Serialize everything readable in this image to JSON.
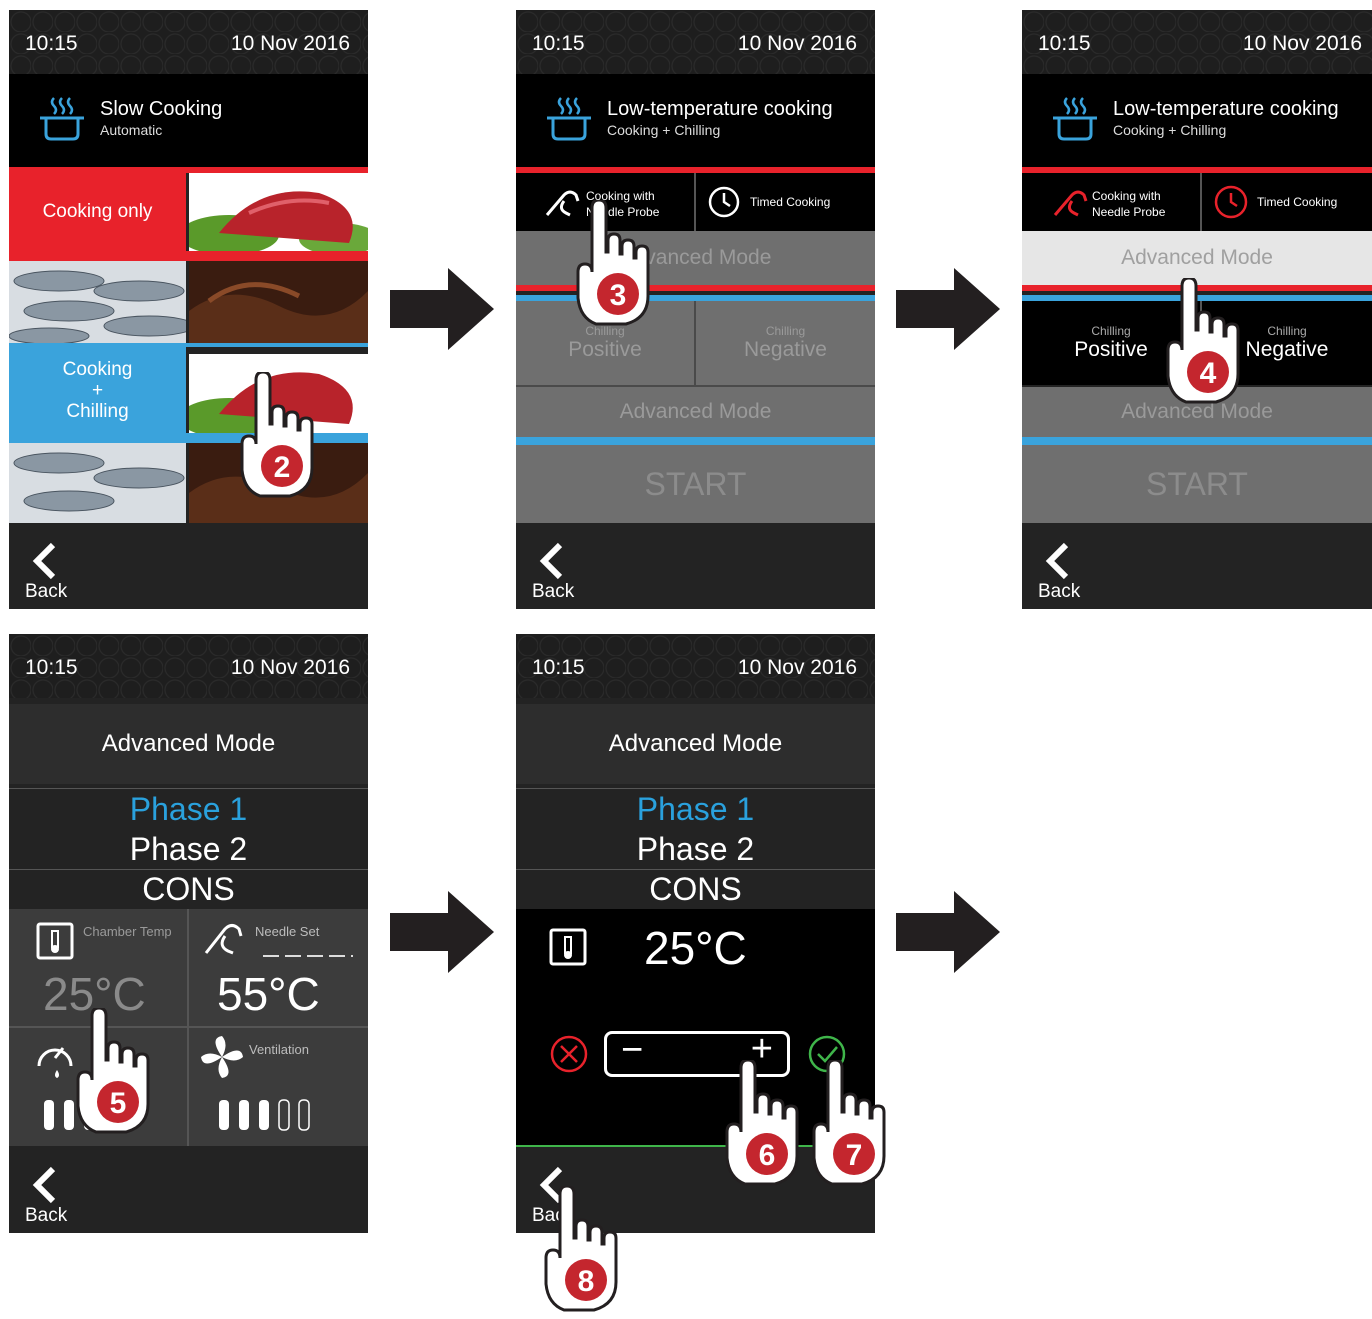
{
  "status": {
    "time": "10:15",
    "date": "10  Nov  2016"
  },
  "footer": {
    "back_label": "Back"
  },
  "screen1": {
    "title": "Slow Cooking",
    "subtitle": "Automatic",
    "cooking_only": "Cooking only",
    "cooking_chilling": [
      "Cooking",
      "+",
      "Chilling"
    ]
  },
  "screen2": {
    "title": "Low-temperature cooking",
    "subtitle": "Cooking + Chilling",
    "probe_label": [
      "Cooking with",
      "Needle Probe"
    ],
    "timed_label": "Timed Cooking",
    "advanced_top": "Advanced Mode",
    "chilling_small": "Chilling",
    "positive": "Positive",
    "negative": "Negative",
    "advanced_bottom": "Advanced Mode",
    "start": "START"
  },
  "screen4": {
    "title": "Advanced Mode",
    "phase1": "Phase 1",
    "phase2": "Phase 2",
    "cons": "CONS",
    "chamber_label": "Chamber Temp",
    "chamber_value": "25°C",
    "needle_label": "Needle Set",
    "needle_value": "55°C",
    "ventilation_label": "Ventilation",
    "speed_level": 3,
    "speed_total": 5,
    "vent_level": 3,
    "vent_total": 5
  },
  "screen5": {
    "title": "Advanced Mode",
    "phase1": "Phase 1",
    "phase2": "Phase 2",
    "cons": "CONS",
    "temp_value": "25°C",
    "minus": "−",
    "plus": "+"
  },
  "steps": [
    "2",
    "3",
    "4",
    "5",
    "6",
    "7",
    "8"
  ],
  "colors": {
    "red": "#e8222b",
    "blue": "#3aa3dc",
    "green": "#3fb54a",
    "phase_active": "#2aa1dd"
  }
}
